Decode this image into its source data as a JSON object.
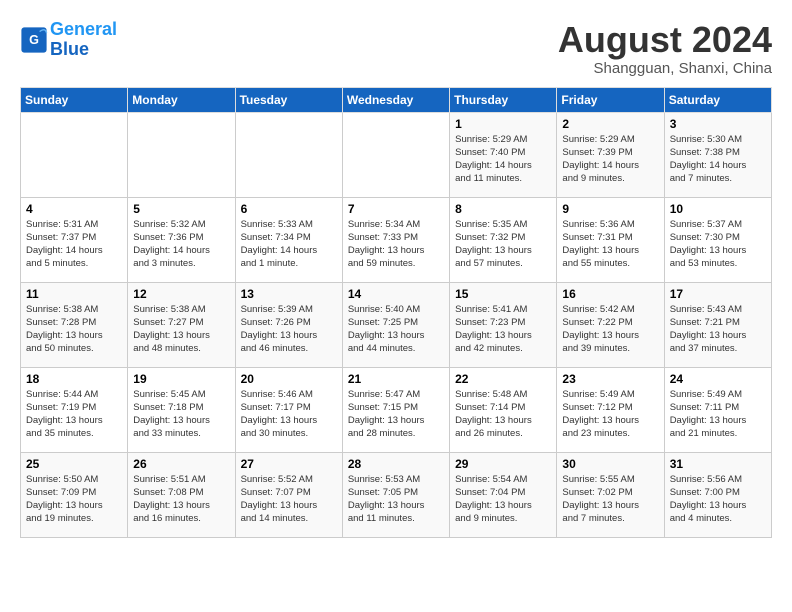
{
  "header": {
    "logo_line1": "General",
    "logo_line2": "Blue",
    "month_title": "August 2024",
    "subtitle": "Shangguan, Shanxi, China"
  },
  "weekdays": [
    "Sunday",
    "Monday",
    "Tuesday",
    "Wednesday",
    "Thursday",
    "Friday",
    "Saturday"
  ],
  "weeks": [
    [
      {
        "day": "",
        "info": ""
      },
      {
        "day": "",
        "info": ""
      },
      {
        "day": "",
        "info": ""
      },
      {
        "day": "",
        "info": ""
      },
      {
        "day": "1",
        "info": "Sunrise: 5:29 AM\nSunset: 7:40 PM\nDaylight: 14 hours\nand 11 minutes."
      },
      {
        "day": "2",
        "info": "Sunrise: 5:29 AM\nSunset: 7:39 PM\nDaylight: 14 hours\nand 9 minutes."
      },
      {
        "day": "3",
        "info": "Sunrise: 5:30 AM\nSunset: 7:38 PM\nDaylight: 14 hours\nand 7 minutes."
      }
    ],
    [
      {
        "day": "4",
        "info": "Sunrise: 5:31 AM\nSunset: 7:37 PM\nDaylight: 14 hours\nand 5 minutes."
      },
      {
        "day": "5",
        "info": "Sunrise: 5:32 AM\nSunset: 7:36 PM\nDaylight: 14 hours\nand 3 minutes."
      },
      {
        "day": "6",
        "info": "Sunrise: 5:33 AM\nSunset: 7:34 PM\nDaylight: 14 hours\nand 1 minute."
      },
      {
        "day": "7",
        "info": "Sunrise: 5:34 AM\nSunset: 7:33 PM\nDaylight: 13 hours\nand 59 minutes."
      },
      {
        "day": "8",
        "info": "Sunrise: 5:35 AM\nSunset: 7:32 PM\nDaylight: 13 hours\nand 57 minutes."
      },
      {
        "day": "9",
        "info": "Sunrise: 5:36 AM\nSunset: 7:31 PM\nDaylight: 13 hours\nand 55 minutes."
      },
      {
        "day": "10",
        "info": "Sunrise: 5:37 AM\nSunset: 7:30 PM\nDaylight: 13 hours\nand 53 minutes."
      }
    ],
    [
      {
        "day": "11",
        "info": "Sunrise: 5:38 AM\nSunset: 7:28 PM\nDaylight: 13 hours\nand 50 minutes."
      },
      {
        "day": "12",
        "info": "Sunrise: 5:38 AM\nSunset: 7:27 PM\nDaylight: 13 hours\nand 48 minutes."
      },
      {
        "day": "13",
        "info": "Sunrise: 5:39 AM\nSunset: 7:26 PM\nDaylight: 13 hours\nand 46 minutes."
      },
      {
        "day": "14",
        "info": "Sunrise: 5:40 AM\nSunset: 7:25 PM\nDaylight: 13 hours\nand 44 minutes."
      },
      {
        "day": "15",
        "info": "Sunrise: 5:41 AM\nSunset: 7:23 PM\nDaylight: 13 hours\nand 42 minutes."
      },
      {
        "day": "16",
        "info": "Sunrise: 5:42 AM\nSunset: 7:22 PM\nDaylight: 13 hours\nand 39 minutes."
      },
      {
        "day": "17",
        "info": "Sunrise: 5:43 AM\nSunset: 7:21 PM\nDaylight: 13 hours\nand 37 minutes."
      }
    ],
    [
      {
        "day": "18",
        "info": "Sunrise: 5:44 AM\nSunset: 7:19 PM\nDaylight: 13 hours\nand 35 minutes."
      },
      {
        "day": "19",
        "info": "Sunrise: 5:45 AM\nSunset: 7:18 PM\nDaylight: 13 hours\nand 33 minutes."
      },
      {
        "day": "20",
        "info": "Sunrise: 5:46 AM\nSunset: 7:17 PM\nDaylight: 13 hours\nand 30 minutes."
      },
      {
        "day": "21",
        "info": "Sunrise: 5:47 AM\nSunset: 7:15 PM\nDaylight: 13 hours\nand 28 minutes."
      },
      {
        "day": "22",
        "info": "Sunrise: 5:48 AM\nSunset: 7:14 PM\nDaylight: 13 hours\nand 26 minutes."
      },
      {
        "day": "23",
        "info": "Sunrise: 5:49 AM\nSunset: 7:12 PM\nDaylight: 13 hours\nand 23 minutes."
      },
      {
        "day": "24",
        "info": "Sunrise: 5:49 AM\nSunset: 7:11 PM\nDaylight: 13 hours\nand 21 minutes."
      }
    ],
    [
      {
        "day": "25",
        "info": "Sunrise: 5:50 AM\nSunset: 7:09 PM\nDaylight: 13 hours\nand 19 minutes."
      },
      {
        "day": "26",
        "info": "Sunrise: 5:51 AM\nSunset: 7:08 PM\nDaylight: 13 hours\nand 16 minutes."
      },
      {
        "day": "27",
        "info": "Sunrise: 5:52 AM\nSunset: 7:07 PM\nDaylight: 13 hours\nand 14 minutes."
      },
      {
        "day": "28",
        "info": "Sunrise: 5:53 AM\nSunset: 7:05 PM\nDaylight: 13 hours\nand 11 minutes."
      },
      {
        "day": "29",
        "info": "Sunrise: 5:54 AM\nSunset: 7:04 PM\nDaylight: 13 hours\nand 9 minutes."
      },
      {
        "day": "30",
        "info": "Sunrise: 5:55 AM\nSunset: 7:02 PM\nDaylight: 13 hours\nand 7 minutes."
      },
      {
        "day": "31",
        "info": "Sunrise: 5:56 AM\nSunset: 7:00 PM\nDaylight: 13 hours\nand 4 minutes."
      }
    ]
  ]
}
